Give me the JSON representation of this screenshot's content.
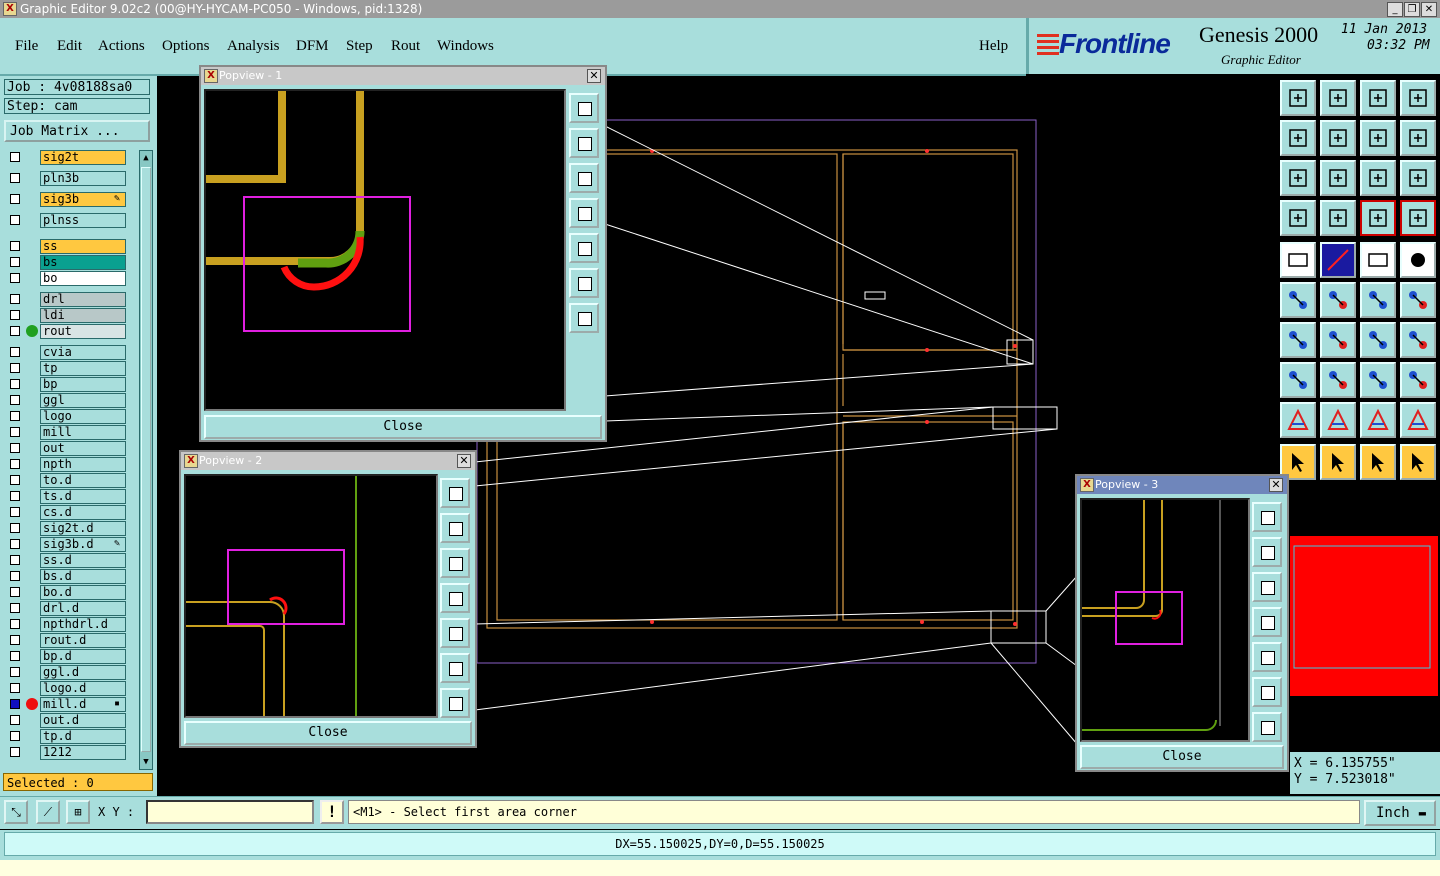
{
  "window": {
    "title": "Graphic Editor 9.02c2 (00@HY-HYCAM-PC050 - Windows, pid:1328)"
  },
  "menu": [
    "File",
    "Edit",
    "Actions",
    "Options",
    "Analysis",
    "DFM",
    "Step",
    "Rout",
    "Windows",
    "Help"
  ],
  "brand": {
    "logo": "Frontline",
    "product": "Genesis 2000",
    "subtitle": "Graphic Editor",
    "date": "11 Jan 2013",
    "time": "03:32 PM"
  },
  "job": {
    "job_label": "Job : 4v08188sa0",
    "step_label": "Step: cam",
    "matrix_button": "Job Matrix ..."
  },
  "layers": [
    {
      "name": "sig2t",
      "bg": "#ffc840"
    },
    {
      "name": "pln3b",
      "bg": "#a8dedc"
    },
    {
      "name": "sig3b",
      "bg": "#ffc840",
      "mark": "✎"
    },
    {
      "name": "plnss",
      "bg": "#a8dedc"
    },
    {
      "name": "ss",
      "bg": "#ffc840"
    },
    {
      "name": "bs",
      "bg": "#0aa090"
    },
    {
      "name": "bo",
      "bg": "#ffffff"
    },
    {
      "name": "drl",
      "bg": "#b8c8c8"
    },
    {
      "name": "ldi",
      "bg": "#b8c8c8"
    },
    {
      "name": "rout",
      "bg": "#d8e4e4",
      "dot": "#20a020"
    },
    {
      "name": "cvia",
      "bg": "#a8dedc"
    },
    {
      "name": "tp",
      "bg": "#a8dedc"
    },
    {
      "name": "bp",
      "bg": "#a8dedc"
    },
    {
      "name": "ggl",
      "bg": "#a8dedc"
    },
    {
      "name": "logo",
      "bg": "#a8dedc"
    },
    {
      "name": "mill",
      "bg": "#a8dedc"
    },
    {
      "name": "out",
      "bg": "#a8dedc"
    },
    {
      "name": "npth",
      "bg": "#a8dedc"
    },
    {
      "name": "to.d",
      "bg": "#a8dedc"
    },
    {
      "name": "ts.d",
      "bg": "#a8dedc"
    },
    {
      "name": "cs.d",
      "bg": "#a8dedc"
    },
    {
      "name": "sig2t.d",
      "bg": "#a8dedc"
    },
    {
      "name": "sig3b.d",
      "bg": "#a8dedc",
      "mark": "✎"
    },
    {
      "name": "ss.d",
      "bg": "#a8dedc"
    },
    {
      "name": "bs.d",
      "bg": "#a8dedc"
    },
    {
      "name": "bo.d",
      "bg": "#a8dedc"
    },
    {
      "name": "drl.d",
      "bg": "#a8dedc"
    },
    {
      "name": "npthdrl.d",
      "bg": "#a8dedc"
    },
    {
      "name": "rout.d",
      "bg": "#a8dedc"
    },
    {
      "name": "bp.d",
      "bg": "#a8dedc"
    },
    {
      "name": "ggl.d",
      "bg": "#a8dedc"
    },
    {
      "name": "logo.d",
      "bg": "#a8dedc"
    },
    {
      "name": "mill.d",
      "bg": "#a8dedc",
      "dot": "#ee1010",
      "cb": "#1010c0",
      "mark": "▪"
    },
    {
      "name": "out.d",
      "bg": "#a8dedc"
    },
    {
      "name": "tp.d",
      "bg": "#a8dedc"
    },
    {
      "name": "1212",
      "bg": "#a8dedc"
    }
  ],
  "selected": "Selected : 0",
  "command": {
    "xy_label": "X Y :",
    "xy_value": "",
    "excl": "!",
    "prompt": "<M1> - Select first area corner",
    "unit": "Inch"
  },
  "status": "DX=55.150025,DY=0,D=55.150025",
  "coords": {
    "x": "X = 6.135755\"",
    "y": "Y = 7.523018\""
  },
  "popups": [
    {
      "title": "Popview - 1",
      "close_label": "Close"
    },
    {
      "title": "Popview - 2",
      "close_label": "Close"
    },
    {
      "title": "Popview - 3",
      "close_label": "Close"
    }
  ],
  "colors": {
    "panel": "#a8dedc",
    "trace": "#c8a020",
    "rout_green": "#50a010",
    "rout_red": "#ff1010",
    "select": "#e020e0",
    "outline": "#8a60c8"
  }
}
